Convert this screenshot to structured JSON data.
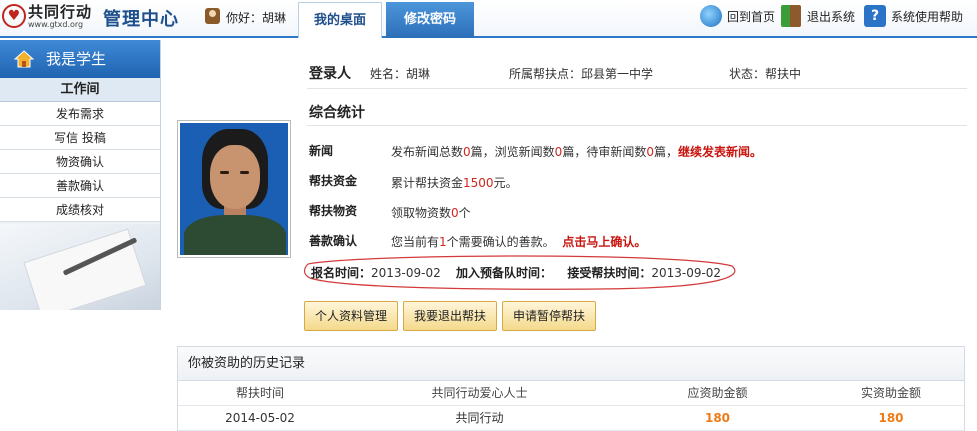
{
  "header": {
    "logo_text": "共同行动",
    "logo_url": "www.gtxd.org",
    "title": "管理中心",
    "greeting": "你好：胡琳",
    "tabs": [
      {
        "label": "我的桌面"
      },
      {
        "label": "修改密码"
      }
    ],
    "links": [
      {
        "label": "回到首页"
      },
      {
        "label": "退出系统"
      },
      {
        "label": "系统使用帮助"
      }
    ]
  },
  "sidebar": {
    "title": "我是学生",
    "section": "工作间",
    "items": [
      {
        "label": "发布需求"
      },
      {
        "label": "写信 投稿"
      },
      {
        "label": "物资确认"
      },
      {
        "label": "善款确认"
      },
      {
        "label": "成绩核对"
      }
    ]
  },
  "profile": {
    "login_label": "登录人",
    "name": "姓名：胡琳",
    "school": "所属帮扶点：邱县第一中学",
    "status": "状态：帮扶中"
  },
  "stats": {
    "title": "综合统计",
    "news_label": "新闻",
    "news_a": "发布新闻总数",
    "news_a_n": "0",
    "news_b": "篇，浏览新闻数",
    "news_b_n": "0",
    "news_c": "篇，待审新闻数",
    "news_c_n": "0",
    "news_d": "篇，",
    "news_link": "继续发表新闻。",
    "funds_label": "帮扶资金",
    "funds_a": "累计帮扶资金",
    "funds_n": "1500",
    "funds_b": "元。",
    "goods_label": "帮扶物资",
    "goods_a": "领取物资数",
    "goods_n": "0",
    "goods_b": "个",
    "donation_label": "善款确认",
    "donation_a": "您当前有",
    "donation_n": "1",
    "donation_b": "个需要确认的善款。",
    "donation_link": "点击马上确认。"
  },
  "dates": {
    "reg_label": "报名时间：",
    "reg_value": "2013-09-02",
    "queue_label": "加入预备队时间：",
    "queue_value": "",
    "accept_label": "接受帮扶时间：",
    "accept_value": "2013-09-02"
  },
  "buttons": [
    {
      "label": "个人资料管理"
    },
    {
      "label": "我要退出帮扶"
    },
    {
      "label": "申请暂停帮扶"
    }
  ],
  "history": {
    "title": "你被资助的历史记录",
    "columns": [
      "帮扶时间",
      "共同行动爱心人士",
      "应资助金额",
      "实资助金额"
    ],
    "rows": [
      {
        "date": "2014-05-02",
        "donor": "共同行动",
        "due": "180",
        "paid": "180"
      }
    ]
  },
  "colors": {
    "accent": "#2b6fb8",
    "red": "#d2261f",
    "amount": "#f07b16",
    "button": "#f4d98c"
  }
}
